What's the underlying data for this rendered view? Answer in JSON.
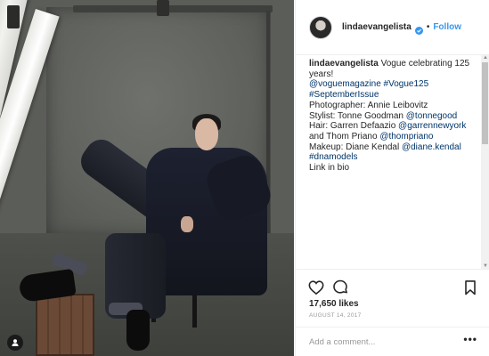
{
  "post": {
    "username": "lindaevangelista",
    "follow_label": "Follow",
    "separator": "•",
    "caption_text": "Vogue celebrating 125 years!",
    "caption_lines": [
      {
        "parts": [
          {
            "t": "@voguemagazine",
            "link": true
          },
          {
            "t": " ",
            "link": false
          },
          {
            "t": "#Vogue125",
            "link": true
          }
        ]
      },
      {
        "parts": [
          {
            "t": "#SeptemberIssue",
            "link": true
          }
        ]
      },
      {
        "parts": [
          {
            "t": "Photographer: Annie Leibovitz",
            "link": false
          }
        ]
      },
      {
        "parts": [
          {
            "t": "Stylist: Tonne Goodman ",
            "link": false
          },
          {
            "t": "@tonnegood",
            "link": true
          }
        ]
      },
      {
        "parts": [
          {
            "t": "Hair: Garren Defaazio ",
            "link": false
          },
          {
            "t": "@garrennewyork",
            "link": true
          }
        ]
      },
      {
        "parts": [
          {
            "t": "and Thom Priano ",
            "link": false
          },
          {
            "t": "@thompriano",
            "link": true
          }
        ]
      },
      {
        "parts": [
          {
            "t": "Makeup: Diane Kendal ",
            "link": false
          },
          {
            "t": "@diane.kendal",
            "link": true
          }
        ]
      },
      {
        "parts": [
          {
            "t": "#dnamodels",
            "link": true
          }
        ]
      },
      {
        "parts": [
          {
            "t": "Link in bio",
            "link": false
          }
        ]
      }
    ],
    "likes": "17,650 likes",
    "date": "August 14, 2017",
    "comment_placeholder": "Add a comment...",
    "more_label": "•••"
  },
  "colors": {
    "link": "#003569",
    "follow": "#3897f0",
    "verified": "#3897f0"
  },
  "icons": [
    "user-tag-icon",
    "heart-icon",
    "comment-icon",
    "bookmark-icon",
    "verified-badge-icon"
  ]
}
